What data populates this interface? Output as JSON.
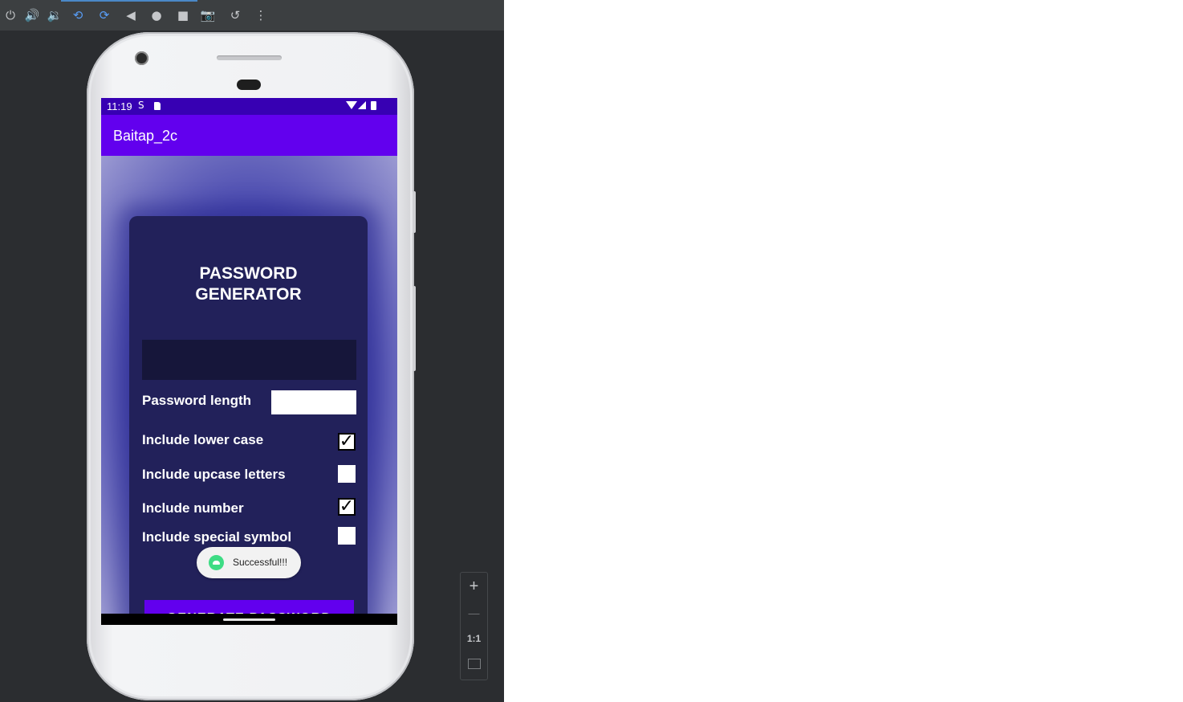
{
  "toolbar": {
    "icons": [
      "power-icon",
      "volume-up-icon",
      "volume-down-icon",
      "rotate-left-icon",
      "rotate-right-icon",
      "back-icon",
      "home-icon",
      "overview-icon",
      "screenshot-icon",
      "snapshot-restore-icon",
      "more-icon"
    ]
  },
  "status_bar": {
    "time": "11:19",
    "icons": [
      "s-notification-icon",
      "sd-card-icon",
      "wifi-icon",
      "signal-icon",
      "battery-icon"
    ]
  },
  "app": {
    "title": "Baitap_2c",
    "card_title": "PASSWORD\nGENERATOR",
    "password_output": "",
    "length_label": "Password length",
    "length_value": "",
    "options": [
      {
        "label": "Include lower case",
        "checked": true
      },
      {
        "label": "Include upcase letters",
        "checked": false
      },
      {
        "label": "Include number",
        "checked": true
      },
      {
        "label": "Include special symbol",
        "checked": false
      }
    ],
    "generate_label": "GENERATE PASSWORD"
  },
  "toast": {
    "text": "Successful!!!"
  },
  "zoom_controls": {
    "zoom_in": "+",
    "zoom_out": "—",
    "actual_size": "1:1"
  },
  "colors": {
    "status_bar": "#3700b3",
    "app_bar": "#6200ee",
    "card": "#22215a",
    "button": "#6200ee",
    "toast_icon": "#3ddc84"
  }
}
